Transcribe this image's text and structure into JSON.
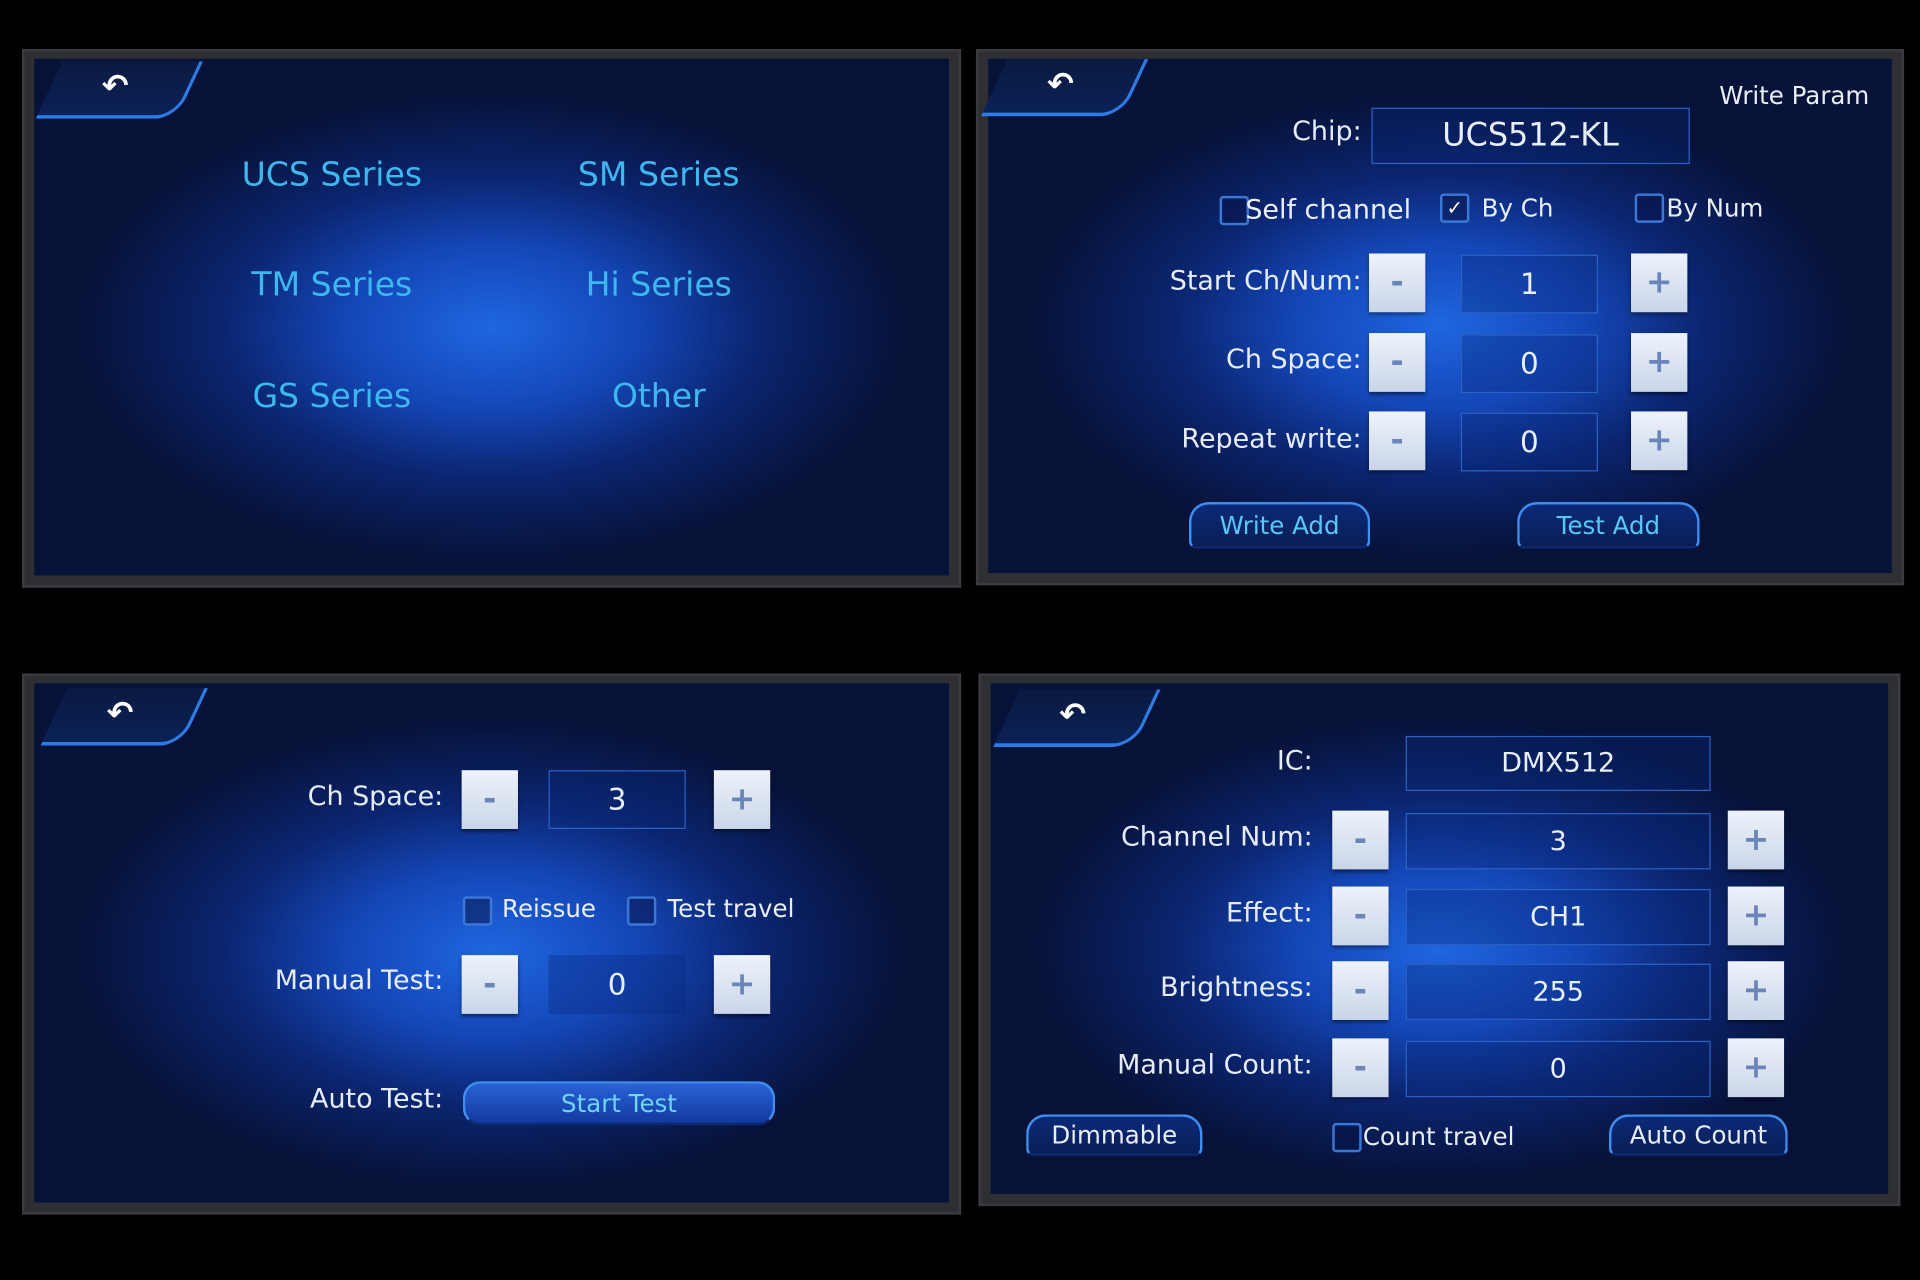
{
  "back_icon": "↶",
  "panel_series": {
    "items": [
      "UCS Series",
      "SM Series",
      "TM Series",
      "Hi Series",
      "GS Series",
      "Other"
    ]
  },
  "panel_write": {
    "title": "Write Param",
    "chip_label": "Chip:",
    "chip_value": "UCS512-KL",
    "options": [
      {
        "label": "Self channel",
        "checked": false
      },
      {
        "label": "By Ch",
        "checked": true
      },
      {
        "label": "By Num",
        "checked": false
      }
    ],
    "rows": [
      {
        "label": "Start Ch/Num:",
        "value": "1"
      },
      {
        "label": "Ch Space:",
        "value": "0"
      },
      {
        "label": "Repeat write:",
        "value": "0"
      }
    ],
    "write_add": "Write Add",
    "test_add": "Test Add"
  },
  "panel_test": {
    "ch_space_label": "Ch Space:",
    "ch_space_value": "3",
    "options": [
      {
        "label": "Reissue",
        "checked": false
      },
      {
        "label": "Test travel",
        "checked": false
      }
    ],
    "manual_label": "Manual Test:",
    "manual_value": "0",
    "auto_label": "Auto Test:",
    "start_test": "Start Test"
  },
  "panel_dmx": {
    "ic_label": "IC:",
    "ic_value": "DMX512",
    "rows": [
      {
        "label": "Channel Num:",
        "value": "3"
      },
      {
        "label": "Effect:",
        "value": "CH1"
      },
      {
        "label": "Brightness:",
        "value": "255"
      },
      {
        "label": "Manual Count:",
        "value": "0"
      }
    ],
    "dimmable": "Dimmable",
    "count_travel": {
      "label": "Count travel",
      "checked": false
    },
    "auto_count": "Auto Count"
  },
  "minus": "-",
  "plus": "+",
  "check": "✓"
}
